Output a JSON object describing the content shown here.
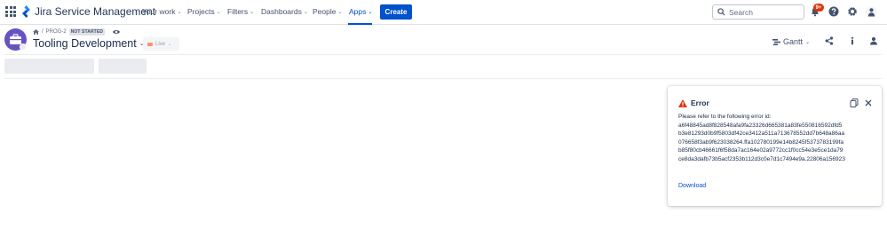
{
  "app": {
    "logo_text": "Jira Service Management"
  },
  "nav": {
    "items": [
      {
        "label": "Your work"
      },
      {
        "label": "Projects"
      },
      {
        "label": "Filters"
      },
      {
        "label": "Dashboards"
      },
      {
        "label": "People"
      },
      {
        "label": "Apps"
      }
    ],
    "active_item": "Apps",
    "create_label": "Create",
    "search_placeholder": "Search",
    "notification_badge": "9+"
  },
  "project": {
    "breadcrumb_key": "PROG-2",
    "status": "NOT STARTED",
    "title": "Tooling Development",
    "live_label": "Live",
    "view_label": "Gantt"
  },
  "error": {
    "title": "Error",
    "lines": [
      "Please refer to the following error id:",
      "a6f48845ad8f828548afa9fa23326d665381a83fe550816592dfd5",
      "b3e81293d0b9f5803df42ce3412a511a713678552dd7b648a86aa",
      "076658f3ab9f623038264.ffa102780199e14b8245f5373783199fa",
      "b85f80cb46661f6f58da7ac164e02a9772cc1f0cc54e3e5ce1da79",
      "ce8da3dafb73b5acf2353b112d3c0e7d1c7494e9a.22806a156923"
    ],
    "download_label": "Download"
  },
  "colors": {
    "brand": "#0052cc",
    "error_icon": "#de350b",
    "project_avatar": "#6554c0"
  }
}
